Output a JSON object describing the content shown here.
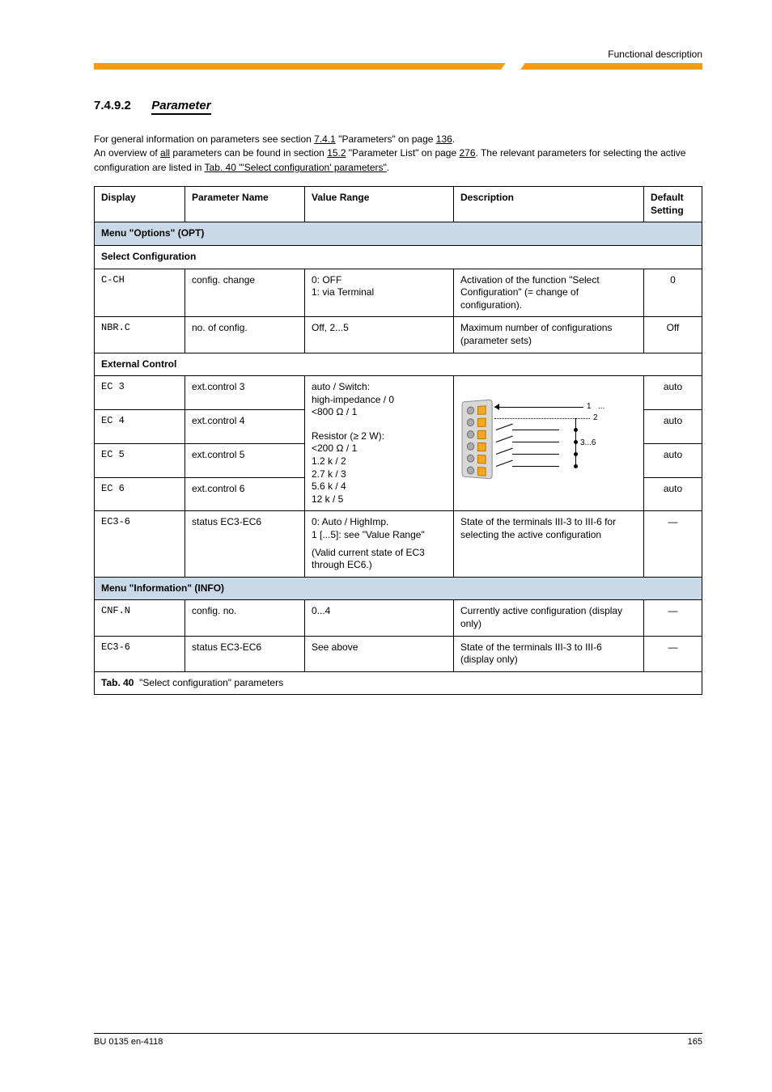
{
  "header": {
    "doc_title": "Functional description"
  },
  "section": {
    "number": "7.4.9.2",
    "title": "Parameter"
  },
  "intro": {
    "p1_pre": "For general information on parameters see section ",
    "p1_link1": "7.4.1",
    "p1_mid": " \"Parameters\" on page ",
    "p1_link2": "136",
    "p1_end": ".",
    "p2_pre": "An overview of ",
    "p2_em": "all",
    "p2_mid": " parameters can be found in section ",
    "p2_link1": "15.2",
    "p2_post": " \"Parameter List\" on page ",
    "p2_link2": "276",
    "p2_end": ". The relevant parameters for selecting the active configuration are listed in ",
    "p2_tab_pre": "Tab. 40",
    "p2_tab_post": " \"'Select configuration' parameters\"",
    "p2_tail": "."
  },
  "table": {
    "headers": {
      "display": "Display",
      "name": "Parameter Name",
      "range": "Value Range",
      "description": "Description",
      "default": "Default Setting"
    },
    "band_menu": "Menu \"Options\" (OPT)",
    "sub_sel_config": "Select Configuration",
    "rows": [
      {
        "display": "C-CH",
        "name": "config. change",
        "range": "0: OFF\n1: via Terminal",
        "desc": "Activation of the function \"Select Configuration\" (= change of configuration).",
        "def": "0"
      },
      {
        "display": "NBR.C",
        "name": "no. of config.",
        "range": "Off, 2...5",
        "desc": "Maximum number of configurations (parameter sets)",
        "def": "Off"
      }
    ],
    "sub_ext_control": "External Control",
    "rows2": [
      {
        "display": "EC 3",
        "name": "ext.control 3",
        "range_lines": [
          "auto / Switch:",
          "high-impedance / 0",
          "<800  / 1"
        ],
        "def": "auto"
      },
      {
        "display": "EC 4",
        "name": "ext.control 4",
        "range_lines": [
          "auto / Switch:",
          "high-impedance / 0",
          "<800  / 1"
        ],
        "def": "auto"
      },
      {
        "display": "EC 5",
        "name": "ext.control 5",
        "range_lines": [
          "auto / Switch:",
          "high-impedance / 0",
          "<800  / 1"
        ],
        "def": "auto"
      },
      {
        "display": "EC 6",
        "name": "ext.control 6",
        "range_lines": [
          "auto / Switch:",
          "high-impedance / 0",
          "<800  / 1",
          "Resistor ( 2 W):",
          "<200  / 1",
          "1.2 k / 2",
          "2.7 k / 3",
          "5.6 k / 4",
          "12 k / 5"
        ],
        "def": "auto"
      },
      {
        "display": "EC3-6",
        "name": "status EC3-EC6",
        "range_lines": [
          "0: Auto / HighImp.",
          "1 [...5]: see \"Value Range\"",
          "(Valid current state of EC3 through EC6.)"
        ],
        "desc": "State of the terminals III-3 to III-6 for selecting the active configuration",
        "def": "—"
      }
    ],
    "band_menu2": "Menu \"Information\" (INFO)",
    "rows3": [
      {
        "display": "CNF.N",
        "name": "config. no.",
        "range": "0...4",
        "desc": "Currently active configuration (display only)",
        "def": "—"
      },
      {
        "display": "EC3-6",
        "name": "status EC3-EC6",
        "range": "See above",
        "desc": "State of the terminals III-3 to III-6 (display only)",
        "def": "—"
      }
    ]
  },
  "diagram_labels": {
    "pin1": "1",
    "pin2": "2",
    "pin36": "3...6",
    "dots": "..."
  },
  "caption": {
    "tab_no": "Tab. 40",
    "tab_text": "\"Select configuration\" parameters"
  },
  "footer": {
    "left": "BU 0135 en-4118",
    "right": "165"
  }
}
